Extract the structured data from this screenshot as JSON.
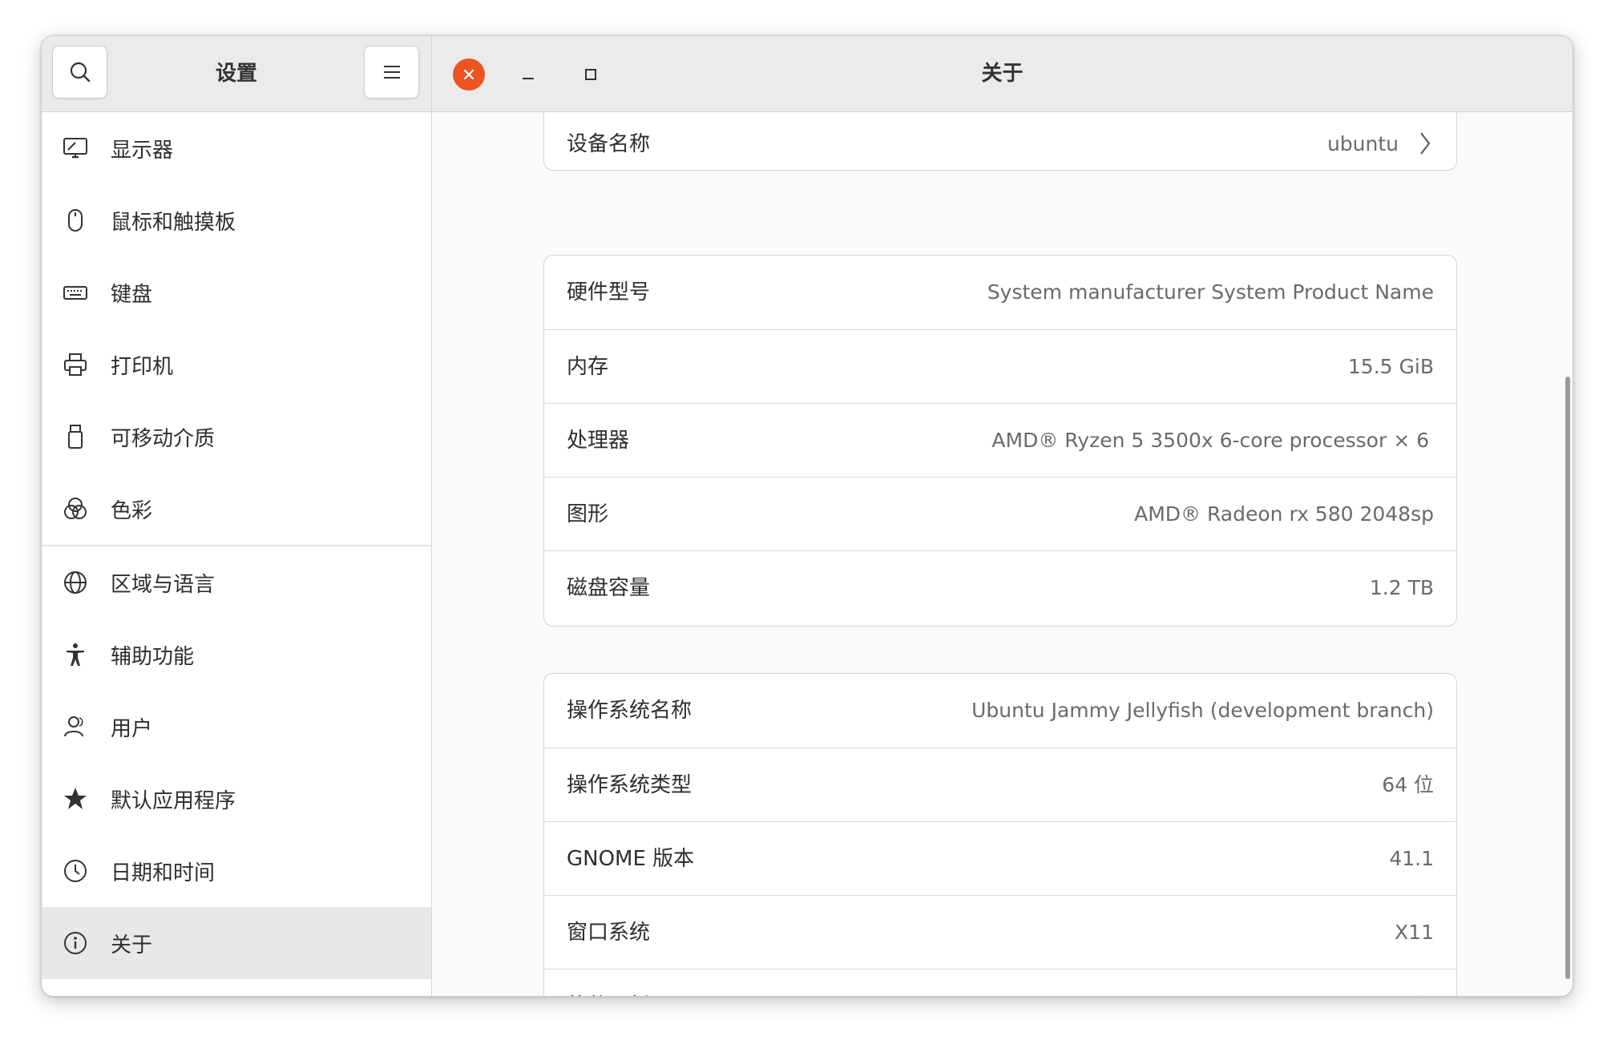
{
  "sidebar": {
    "title": "设置",
    "items": [
      {
        "label": "显示器",
        "icon": "display-icon"
      },
      {
        "label": "鼠标和触摸板",
        "icon": "mouse-icon"
      },
      {
        "label": "键盘",
        "icon": "keyboard-icon"
      },
      {
        "label": "打印机",
        "icon": "printer-icon"
      },
      {
        "label": "可移动介质",
        "icon": "usb-drive-icon"
      },
      {
        "label": "色彩",
        "icon": "color-icon"
      },
      {
        "label": "区域与语言",
        "icon": "globe-icon"
      },
      {
        "label": "辅助功能",
        "icon": "accessibility-icon"
      },
      {
        "label": "用户",
        "icon": "users-icon"
      },
      {
        "label": "默认应用程序",
        "icon": "star-icon"
      },
      {
        "label": "日期和时间",
        "icon": "clock-icon"
      },
      {
        "label": "关于",
        "icon": "info-icon",
        "active": true
      }
    ]
  },
  "main": {
    "title": "关于",
    "device": {
      "label": "设备名称",
      "value": "ubuntu"
    },
    "hardware": [
      {
        "label": "硬件型号",
        "value": "System manufacturer System Product Name"
      },
      {
        "label": "内存",
        "value": "15.5 GiB"
      },
      {
        "label": "处理器",
        "value": "AMD® Ryzen 5 3500x 6-core processor × 6"
      },
      {
        "label": "图形",
        "value": "AMD® Radeon rx 580 2048sp"
      },
      {
        "label": "磁盘容量",
        "value": "1.2 TB"
      }
    ],
    "os": [
      {
        "label": "操作系统名称",
        "value": "Ubuntu Jammy Jellyfish (development branch)"
      },
      {
        "label": "操作系统类型",
        "value": "64 位"
      },
      {
        "label": "GNOME 版本",
        "value": "41.1"
      },
      {
        "label": "窗口系统",
        "value": "X11"
      },
      {
        "label": "软件更新",
        "value": ""
      }
    ]
  },
  "colors": {
    "close": "#e95420",
    "active_item": "#e8e8e8"
  }
}
